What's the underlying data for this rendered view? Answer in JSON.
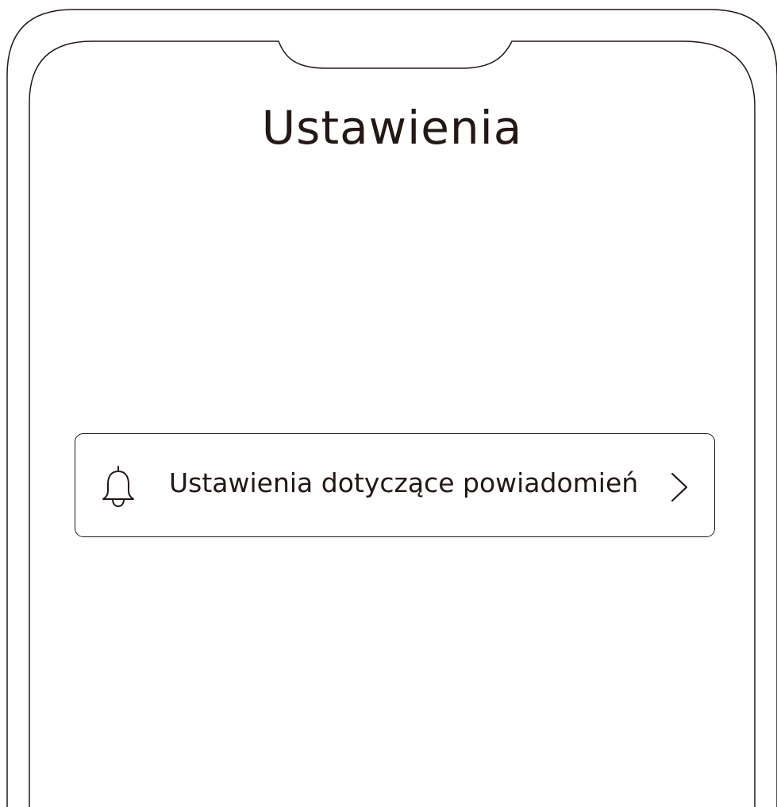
{
  "header": {
    "title": "Ustawienia"
  },
  "settings": {
    "items": [
      {
        "label": "Ustawienia dotyczące powiadomień",
        "icon": "bell-icon",
        "trailing_icon": "chevron-right-icon"
      }
    ]
  },
  "colors": {
    "ink": "#231815",
    "background": "#ffffff"
  }
}
